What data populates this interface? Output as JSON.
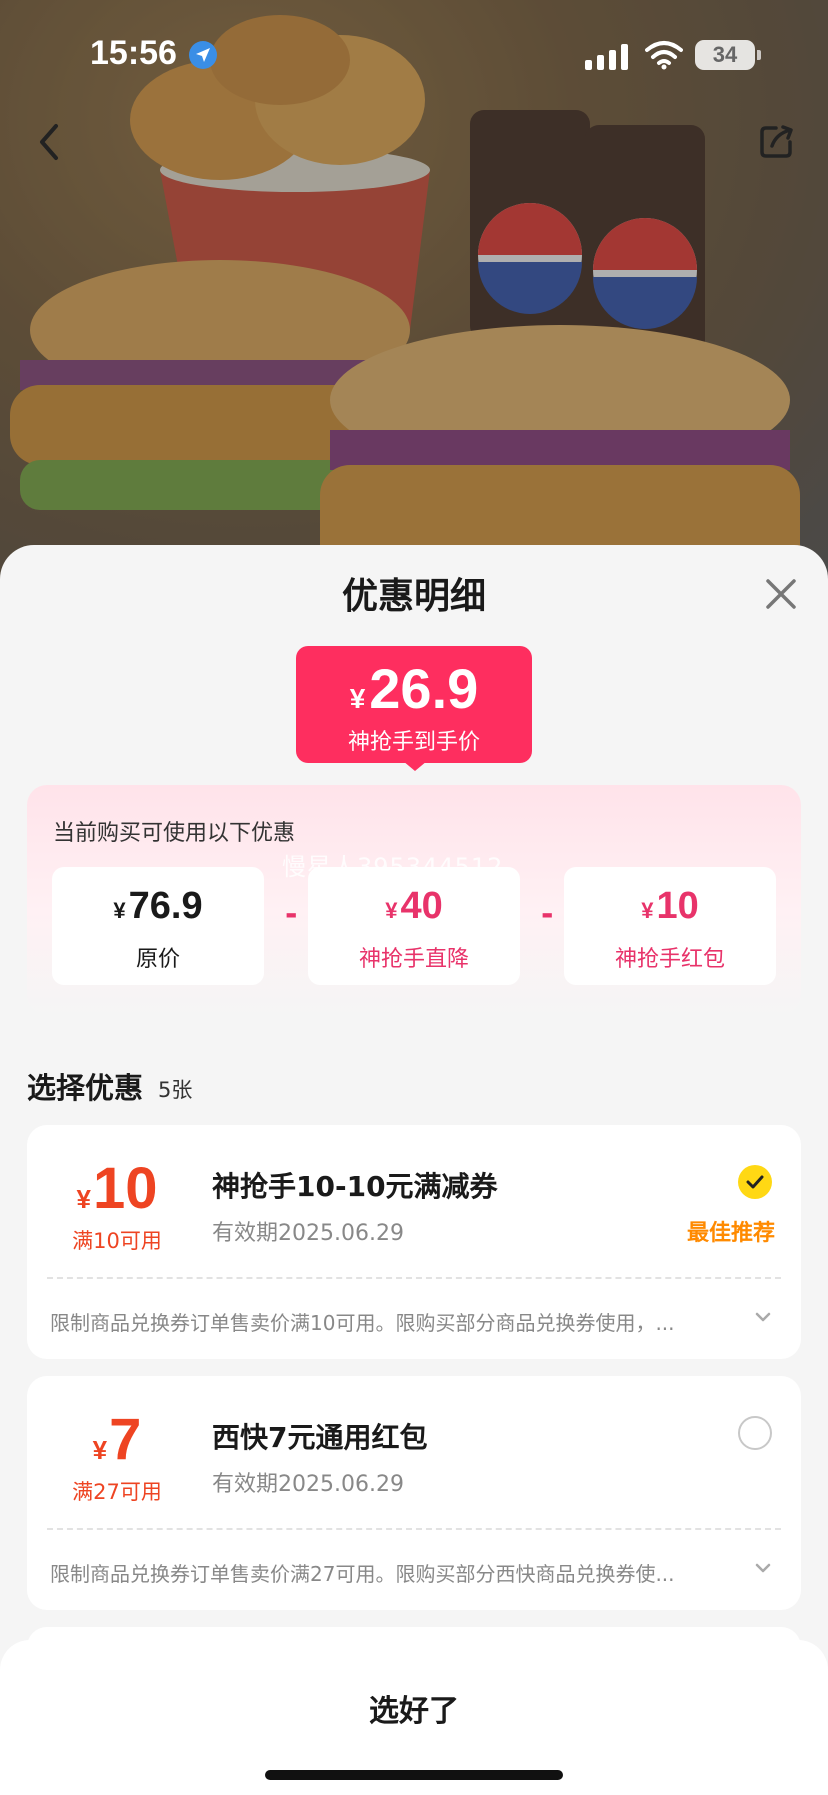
{
  "status_bar": {
    "time": "15:56",
    "battery": "34"
  },
  "sheet": {
    "title": "优惠明细",
    "final_price": {
      "currency": "¥",
      "amount": "26.9",
      "label": "神抢手到手价"
    },
    "breakdown": {
      "label": "当前购买可使用以下优惠",
      "watermark": "慢星人395344512",
      "items": [
        {
          "currency": "¥",
          "amount": "76.9",
          "label": "原价"
        },
        {
          "currency": "¥",
          "amount": "40",
          "label": "神抢手直降"
        },
        {
          "currency": "¥",
          "amount": "10",
          "label": "神抢手红包"
        }
      ],
      "operator": "-"
    },
    "choose": {
      "title": "选择优惠",
      "count": "5张"
    },
    "coupons": [
      {
        "currency": "¥",
        "amount": "10",
        "condition": "满10可用",
        "name": "神抢手10-10元满减券",
        "validity": "有效期2025.06.29",
        "badge": "最佳推荐",
        "selected": true,
        "description": "限制商品兑换券订单售卖价满10可用。限购买部分商品兑换券使用，..."
      },
      {
        "currency": "¥",
        "amount": "7",
        "condition": "满27可用",
        "name": "西快7元通用红包",
        "validity": "有效期2025.06.29",
        "badge": "",
        "selected": false,
        "description": "限制商品兑换券订单售卖价满27可用。限购买部分西快商品兑换券使..."
      }
    ],
    "done_button": "选好了"
  },
  "colors": {
    "accent_pink": "#fe2e5f",
    "coupon_red": "#ee4422",
    "best_orange": "#ff8a00",
    "check_yellow": "#ffd814"
  }
}
